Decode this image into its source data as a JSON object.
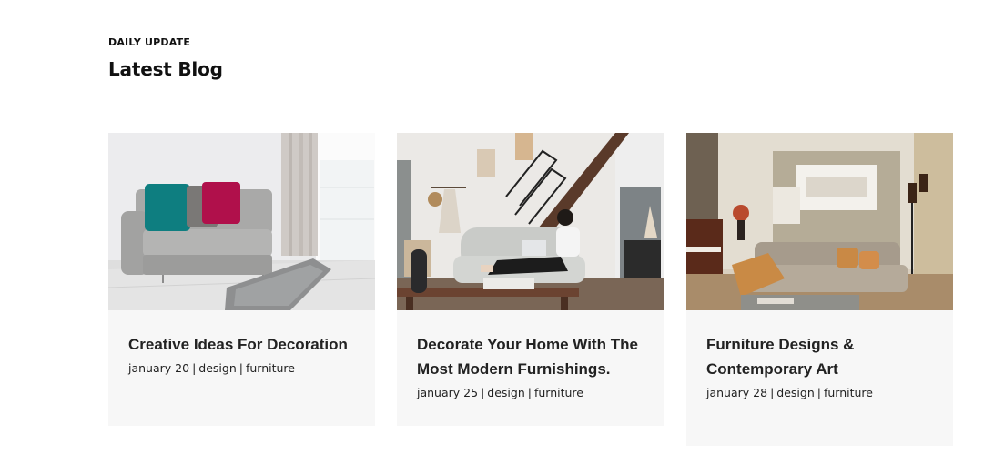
{
  "section": {
    "eyebrow": "DAILY UPDATE",
    "heading": "Latest Blog"
  },
  "posts": [
    {
      "image": "living-room-grey-sofa-photo",
      "title": "Creative Ideas For Decoration",
      "date": "january 20",
      "category": "design",
      "tag": "furniture"
    },
    {
      "image": "woman-on-sofa-with-laptop-photo",
      "title": "Decorate Your Home With The Most Modern Furnishings.",
      "date": "january 25",
      "category": "design",
      "tag": "furniture"
    },
    {
      "image": "contemporary-living-room-photo",
      "title": "Furniture Designs & Contemporary Art",
      "date": "january 28",
      "category": "design",
      "tag": "furniture"
    }
  ],
  "colors": {
    "card_background": "#f7f7f7",
    "text": "#222222"
  }
}
